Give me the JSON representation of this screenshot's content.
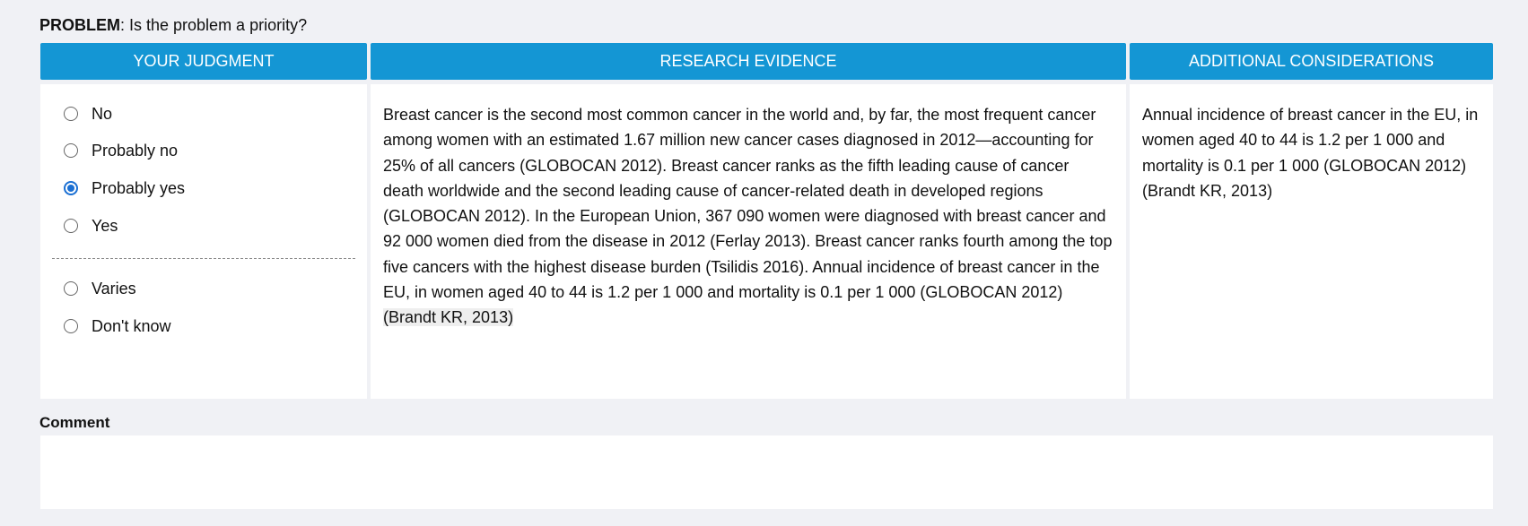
{
  "problem": {
    "label": "PROBLEM",
    "question": ": Is the problem a priority?"
  },
  "headers": {
    "judgment": "YOUR JUDGMENT",
    "evidence": "RESEARCH EVIDENCE",
    "additional": "ADDITIONAL CONSIDERATIONS"
  },
  "judgment_options": [
    {
      "label": "No",
      "checked": false
    },
    {
      "label": "Probably no",
      "checked": false
    },
    {
      "label": "Probably yes",
      "checked": true
    },
    {
      "label": "Yes",
      "checked": false
    },
    {
      "label": "Varies",
      "checked": false
    },
    {
      "label": "Don't know",
      "checked": false
    }
  ],
  "evidence": {
    "text": "Breast cancer is the second most common cancer in the world and, by far, the most frequent cancer among women with an estimated 1.67 million new cancer cases diagnosed in 2012—accounting for 25% of all cancers (GLOBOCAN 2012). Breast cancer ranks as the fifth leading cause of cancer death worldwide and the second leading cause of cancer-related death in developed regions (GLOBOCAN 2012). In the European Union, 367 090 women were diagnosed with breast cancer and 92 000 women died from the disease in 2012 (Ferlay 2013). Breast cancer ranks fourth among the top five cancers with the highest disease burden (Tsilidis 2016). Annual incidence of breast cancer in the EU, in women aged 40 to 44 is 1.2 per 1 000 and mortality is 0.1 per 1 000 (GLOBOCAN 2012)",
    "citation": "(Brandt KR, 2013)"
  },
  "additional": {
    "text": "Annual incidence of breast cancer in the EU, in women aged 40 to 44 is 1.2 per 1 000 and mortality is 0.1 per 1 000 (GLOBOCAN 2012)(Brandt KR, 2013)"
  },
  "comment": {
    "label": "Comment",
    "value": ""
  },
  "colors": {
    "header_bg": "#1496d4",
    "page_bg": "#f0f1f5",
    "radio_checked": "#1a6fd3"
  }
}
